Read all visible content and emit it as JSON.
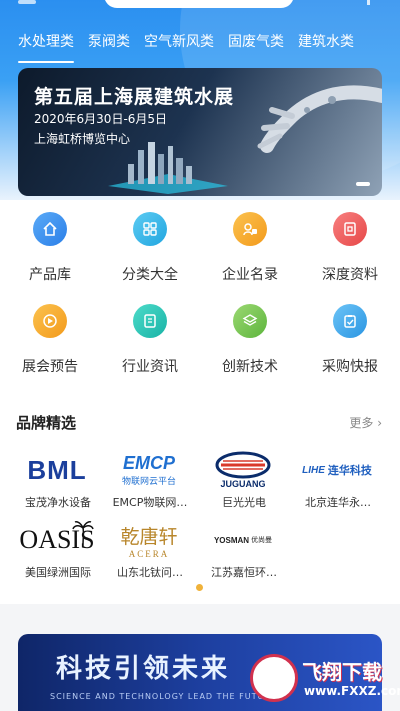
{
  "tabs": [
    {
      "label": "水处理类",
      "active": true
    },
    {
      "label": "泵阀类",
      "active": false
    },
    {
      "label": "空气新风类",
      "active": false
    },
    {
      "label": "固废气类",
      "active": false
    },
    {
      "label": "建筑水类",
      "active": false
    }
  ],
  "banner": {
    "title": "第五届上海展建筑水展",
    "date": "2020年6月30日-6月5日",
    "place": "上海虹桥博览中心"
  },
  "menu": [
    {
      "label": "产品库",
      "icon": "home-icon",
      "color": "#3a8ff0"
    },
    {
      "label": "分类大全",
      "icon": "grid-icon",
      "color": "#35b3e8"
    },
    {
      "label": "企业名录",
      "icon": "building-icon",
      "color": "#f5a623"
    },
    {
      "label": "深度资料",
      "icon": "document-icon",
      "color": "#ef5c5c"
    },
    {
      "label": "展会预告",
      "icon": "calendar-icon",
      "color": "#f5a623"
    },
    {
      "label": "行业资讯",
      "icon": "news-icon",
      "color": "#27c2b7"
    },
    {
      "label": "创新技术",
      "icon": "layers-icon",
      "color": "#7cc55a"
    },
    {
      "label": "采购快报",
      "icon": "clipboard-icon",
      "color": "#3ea9ec"
    }
  ],
  "brands": {
    "title": "品牌精选",
    "more": "更多 ›",
    "items": [
      {
        "name": "宝茂净水设备",
        "logo_text": "BML"
      },
      {
        "name": "EMCP物联网…",
        "logo_text": "EMCP",
        "logo_sub": "物联网云平台"
      },
      {
        "name": "巨光光电",
        "logo_text": "JUGUANG"
      },
      {
        "name": "北京连华永…",
        "logo_text": "连华科技",
        "logo_prefix": "LIHE"
      },
      {
        "name": "美国绿洲国际",
        "logo_text": "OASIS"
      },
      {
        "name": "山东北钛问…",
        "logo_text": "乾唐轩",
        "logo_sub": "ACERA"
      },
      {
        "name": "江苏嘉恒环…",
        "logo_text": "YOSMAN",
        "logo_sub": "优尚曼"
      }
    ]
  },
  "bottom_banner": {
    "title": "科技引领未来",
    "subtitle": "SCIENCE AND TECHNOLOGY LEAD THE FUTURE"
  },
  "watermark": {
    "text": "飞翔下载",
    "url": "www.FXXZ.com"
  },
  "colors": {
    "header_blue": "#2b8ff0",
    "indicator": "#f0b23a"
  }
}
